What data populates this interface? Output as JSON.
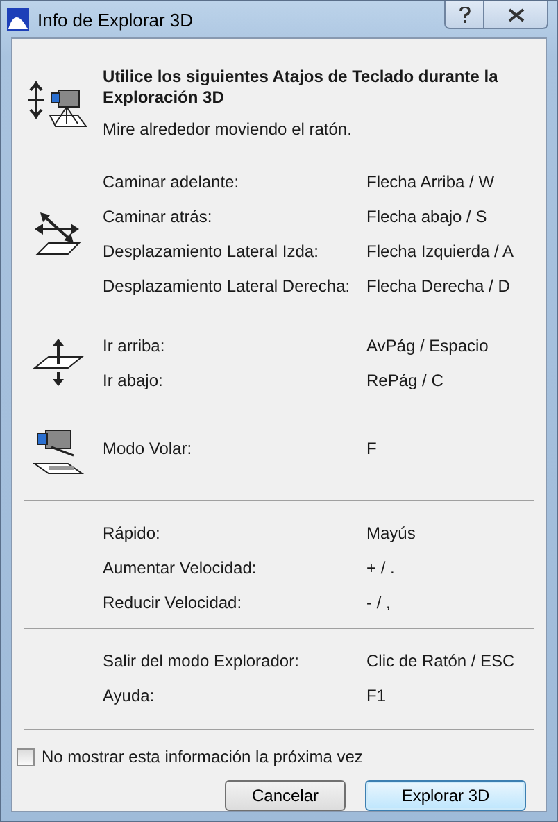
{
  "window": {
    "title": "Info de Explorar 3D"
  },
  "sections": [
    {
      "groups": [
        {
          "kind": "look",
          "heading": "Utilice los siguientes Atajos de Teclado durante la Exploración 3D",
          "note": "Mire alrededor moviendo el ratón."
        },
        {
          "kind": "walk",
          "rows": [
            {
              "action": "Caminar adelante:",
              "keys": "Flecha Arriba / W"
            },
            {
              "action": "Caminar atrás:",
              "keys": "Flecha abajo / S"
            },
            {
              "action": "Desplazamiento Lateral Izda:",
              "keys": "Flecha Izquierda / A"
            },
            {
              "action": "Desplazamiento Lateral Derecha:",
              "keys": "Flecha Derecha / D"
            }
          ]
        },
        {
          "kind": "updown",
          "rows": [
            {
              "action": "Ir arriba:",
              "keys": "AvPág / Espacio"
            },
            {
              "action": "Ir abajo:",
              "keys": "RePág / C"
            }
          ]
        },
        {
          "kind": "fly",
          "rows": [
            {
              "action": "Modo Volar:",
              "keys": "F"
            }
          ]
        }
      ]
    },
    {
      "groups": [
        {
          "kind": "plain",
          "rows": [
            {
              "action": "Rápido:",
              "keys": "Mayús"
            },
            {
              "action": "Aumentar Velocidad:",
              "keys": "+ / ."
            },
            {
              "action": "Reducir Velocidad:",
              "keys": "- / ,"
            }
          ]
        }
      ]
    },
    {
      "groups": [
        {
          "kind": "plain",
          "rows": [
            {
              "action": "Salir del modo Explorador:",
              "keys": "Clic de Ratón / ESC"
            },
            {
              "action": "Ayuda:",
              "keys": "F1"
            }
          ]
        }
      ]
    }
  ],
  "checkbox": {
    "label": "No mostrar esta información la próxima vez",
    "checked": false
  },
  "buttons": [
    {
      "label": "Cancelar",
      "default": false
    },
    {
      "label": "Explorar 3D",
      "default": true
    }
  ]
}
